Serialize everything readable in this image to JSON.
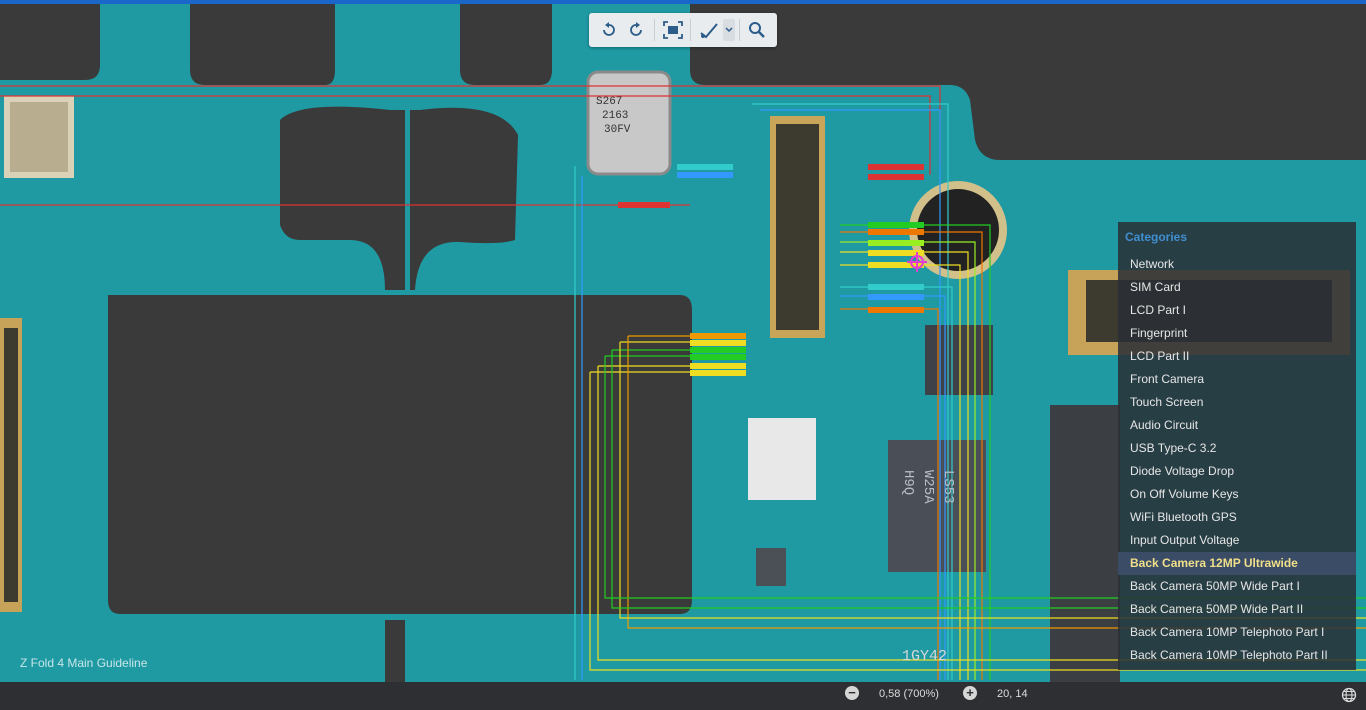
{
  "toolbar": {
    "buttons": [
      {
        "name": "rotate-left-icon"
      },
      {
        "name": "rotate-right-icon"
      },
      {
        "name": "fit-screen-icon"
      },
      {
        "name": "measure-tool-icon"
      },
      {
        "name": "search-icon"
      }
    ]
  },
  "categories": {
    "title": "Categories",
    "items": [
      {
        "label": "Network"
      },
      {
        "label": "SIM Card"
      },
      {
        "label": "LCD Part I"
      },
      {
        "label": "Fingerprint"
      },
      {
        "label": "LCD Part II"
      },
      {
        "label": "Front Camera"
      },
      {
        "label": "Touch Screen"
      },
      {
        "label": "Audio Circuit"
      },
      {
        "label": "USB Type-C 3.2"
      },
      {
        "label": "Diode Voltage Drop"
      },
      {
        "label": "On Off Volume Keys"
      },
      {
        "label": "WiFi Bluetooth GPS"
      },
      {
        "label": "Input Output Voltage"
      },
      {
        "label": "Back Camera 12MP Ultrawide",
        "active": true
      },
      {
        "label": "Back Camera 50MP Wide Part I"
      },
      {
        "label": "Back Camera 50MP Wide Part II"
      },
      {
        "label": "Back Camera 10MP Telephoto Part I"
      },
      {
        "label": "Back Camera 10MP Telephoto Part II"
      }
    ]
  },
  "board": {
    "title": "Z Fold 4 Main Guideline",
    "chip_markings": {
      "crystal": [
        "S267",
        "2163",
        "30FV"
      ],
      "ic_left": "LS53",
      "ic_mid": "W25A",
      "ic_right": "H9Q",
      "bottom_label": "1GY42"
    }
  },
  "status": {
    "zoom_out": "−",
    "zoom": "0,58 (700%)",
    "zoom_in": "+",
    "coords": "20, 14"
  },
  "colors": {
    "pcb": "#1f9aa3",
    "pcb_dark": "#16808a",
    "background": "#3a3a3a",
    "accent": "#1b66c9",
    "active_item": "#f1df8a"
  }
}
